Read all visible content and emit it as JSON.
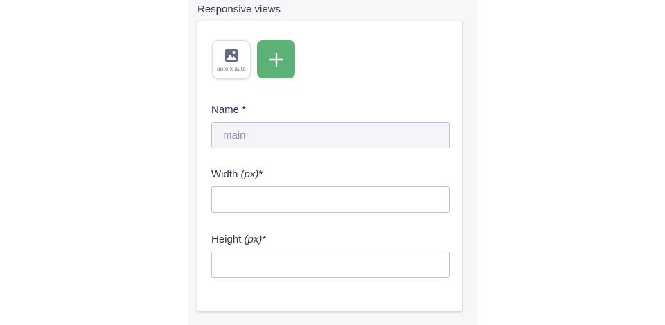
{
  "section": {
    "title": "Responsive views"
  },
  "views": [
    {
      "label": "auto x auto",
      "icon": "image-icon"
    }
  ],
  "add_view": {
    "icon": "plus-icon",
    "color": "#5cb176"
  },
  "form": {
    "name": {
      "label": "Name *",
      "value": "main",
      "disabled": true
    },
    "width": {
      "label_prefix": "Width ",
      "label_unit": "(px)",
      "label_suffix": "*",
      "value": ""
    },
    "height": {
      "label_prefix": "Height ",
      "label_unit": "(px)",
      "label_suffix": "*",
      "value": ""
    }
  }
}
